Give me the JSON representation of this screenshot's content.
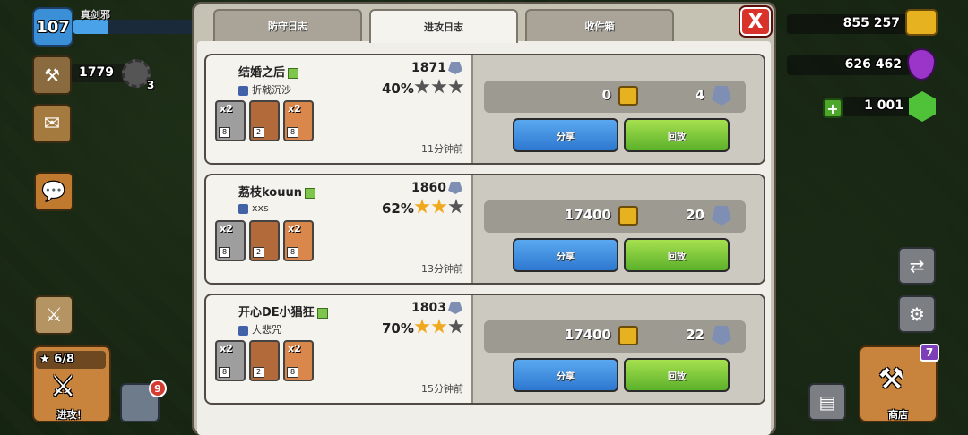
{
  "hud": {
    "level": "107",
    "player_name": "真剑邪",
    "xp_fraction": 0.28,
    "trophies": "1779",
    "builder_count": "3",
    "attack_stars": "6/8",
    "attack_label": "进攻！",
    "shield_badge": "9",
    "gold": "855 257",
    "elixir": "626 462",
    "gems": "1 001",
    "shop_label": "商店",
    "shop_badge": "7",
    "close_label": "X",
    "plus_label": "+"
  },
  "tabs": [
    {
      "label": "防守日志",
      "active": false
    },
    {
      "label": "进攻日志",
      "active": true
    },
    {
      "label": "收件箱",
      "active": false
    }
  ],
  "attacks": [
    {
      "player": "结婚之后",
      "clan": "折戟沉沙",
      "trophies": "1871",
      "percent": "40%",
      "stars": 0,
      "troops": [
        {
          "type": "cannon",
          "mult": "x2",
          "level": "8"
        },
        {
          "type": "hero",
          "mult": "",
          "level": "2"
        },
        {
          "type": "golem",
          "mult": "x2",
          "level": "8"
        }
      ],
      "time": "11分钟前",
      "loot_gold": "0",
      "loot_trophies": "4",
      "share_label": "分享",
      "replay_label": "回放"
    },
    {
      "player": "荔枝kouun",
      "clan": "xxs",
      "trophies": "1860",
      "percent": "62%",
      "stars": 2,
      "troops": [
        {
          "type": "cannon",
          "mult": "x2",
          "level": "8"
        },
        {
          "type": "hero",
          "mult": "",
          "level": "2"
        },
        {
          "type": "golem",
          "mult": "x2",
          "level": "8"
        }
      ],
      "time": "13分钟前",
      "loot_gold": "17400",
      "loot_trophies": "20",
      "share_label": "分享",
      "replay_label": "回放"
    },
    {
      "player": "开心DE小猖狂",
      "clan": "大悲咒",
      "trophies": "1803",
      "percent": "70%",
      "stars": 2,
      "troops": [
        {
          "type": "cannon",
          "mult": "x2",
          "level": "8"
        },
        {
          "type": "hero",
          "mult": "",
          "level": "2"
        },
        {
          "type": "golem",
          "mult": "x2",
          "level": "8"
        }
      ],
      "time": "15分钟前",
      "loot_gold": "17400",
      "loot_trophies": "22",
      "share_label": "分享",
      "replay_label": "回放"
    }
  ]
}
